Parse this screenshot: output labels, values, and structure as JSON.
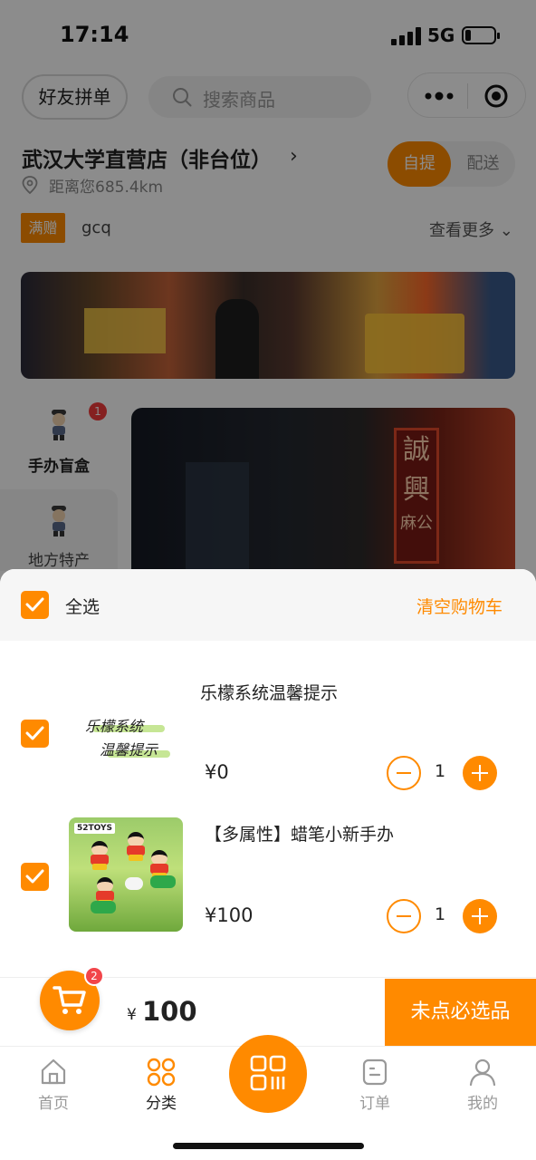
{
  "status_bar": {
    "time": "17:14",
    "network": "5G",
    "battery_level": 0.2
  },
  "header": {
    "friend_button": "好友拼单",
    "search_placeholder": "搜索商品",
    "more_icon": "more-dots-icon",
    "close_icon": "target-close-icon"
  },
  "store": {
    "name": "武汉大学直营店（非台位）",
    "distance": "距离您685.4km",
    "mode_pickup": "自提",
    "mode_delivery": "配送",
    "promo_tag": "满赠",
    "promo_text": "gcq",
    "see_more": "查看更多"
  },
  "categories": [
    {
      "label": "手办盲盒",
      "badge": "1",
      "active": true
    },
    {
      "label": "地方特产",
      "active": false
    }
  ],
  "cart_sheet": {
    "select_all": "全选",
    "clear_cart": "清空购物车",
    "items": [
      {
        "title": "乐檬系统温馨提示",
        "price": "¥0",
        "qty": "1",
        "thumb_line1": "乐檬系统",
        "thumb_line2": "温馨提示",
        "checked": true
      },
      {
        "title": "【多属性】蜡笔小新手办",
        "price": "¥100",
        "qty": "1",
        "thumb_brand": "52TOYS",
        "checked": true
      }
    ]
  },
  "cart_bar": {
    "count": "2",
    "currency": "¥",
    "total": "100",
    "must_select_button": "未点必选品"
  },
  "tabbar": {
    "tabs": [
      {
        "label": "首页",
        "icon": "home-icon",
        "active": false
      },
      {
        "label": "分类",
        "icon": "category-grid-icon",
        "active": true
      },
      {
        "label": "订单",
        "icon": "order-icon",
        "active": false
      },
      {
        "label": "我的",
        "icon": "profile-icon",
        "active": false
      }
    ],
    "scan_icon": "scan-qr-icon"
  },
  "colors": {
    "accent": "#ff8a00",
    "badge": "#f23b3b",
    "overlay": "rgba(0,0,0,0.45)"
  }
}
